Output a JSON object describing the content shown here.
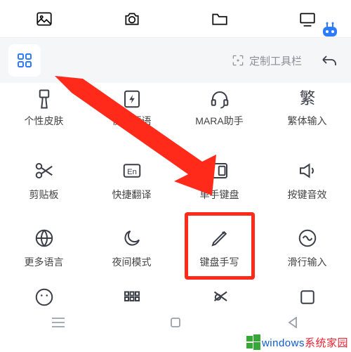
{
  "toolbar_custom_label": "定制工具栏",
  "tools": {
    "r0": [
      "个性皮肤",
      "快捷短语",
      "MARA助手",
      "繁体输入"
    ],
    "r1": [
      "剪贴板",
      "快捷翻译",
      "单手键盘",
      "按键音效"
    ],
    "r2": [
      "更多语言",
      "夜间模式",
      "键盘手写",
      "滑行输入"
    ]
  },
  "watermark": {
    "brand_en": "windows",
    "brand_cn": "系统家园"
  }
}
